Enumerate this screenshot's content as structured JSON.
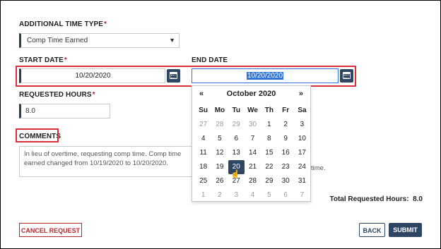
{
  "form": {
    "additional_time_type": {
      "label": "ADDITIONAL TIME TYPE",
      "required": "*",
      "value": "Comp Time Earned"
    },
    "start_date": {
      "label": "START DATE",
      "required": "*",
      "value": "10/20/2020"
    },
    "end_date": {
      "label": "END DATE",
      "value": "10/20/2020"
    },
    "requested_hours": {
      "label": "REQUESTED HOURS",
      "required": "*",
      "value": "8.0"
    },
    "comments": {
      "label": "COMMENTS",
      "value": "In lieu of overtime, requesting comp time. Comp time earned changed from 10/19/2020 to 10/20/2020.",
      "tail": "time."
    },
    "total": {
      "label": "Total Requested Hours:",
      "value": "8.0"
    }
  },
  "datepicker": {
    "prev": "«",
    "next": "»",
    "month_label": "October 2020",
    "weekdays": [
      "Su",
      "Mo",
      "Tu",
      "We",
      "Th",
      "Fr",
      "Sa"
    ],
    "weeks": [
      [
        "27",
        "28",
        "29",
        "30",
        "1",
        "2",
        "3"
      ],
      [
        "4",
        "5",
        "6",
        "7",
        "8",
        "9",
        "10"
      ],
      [
        "11",
        "12",
        "13",
        "14",
        "15",
        "16",
        "17"
      ],
      [
        "18",
        "19",
        "20",
        "21",
        "22",
        "23",
        "24"
      ],
      [
        "25",
        "26",
        "27",
        "28",
        "29",
        "30",
        "31"
      ],
      [
        "1",
        "2",
        "3",
        "4",
        "5",
        "6",
        "7"
      ]
    ],
    "selected": "20"
  },
  "buttons": {
    "cancel": "CANCEL REQUEST",
    "back": "BACK",
    "submit": "SUBMIT"
  },
  "colors": {
    "accent": "#2e4662",
    "required": "#c0192c",
    "highlight_box": "#d6313b",
    "cancel": "#b02a30"
  },
  "icons": {
    "calendar": "calendar-icon",
    "select_arrow": "chevron-down-icon",
    "cursor": "hand-pointer-icon"
  }
}
